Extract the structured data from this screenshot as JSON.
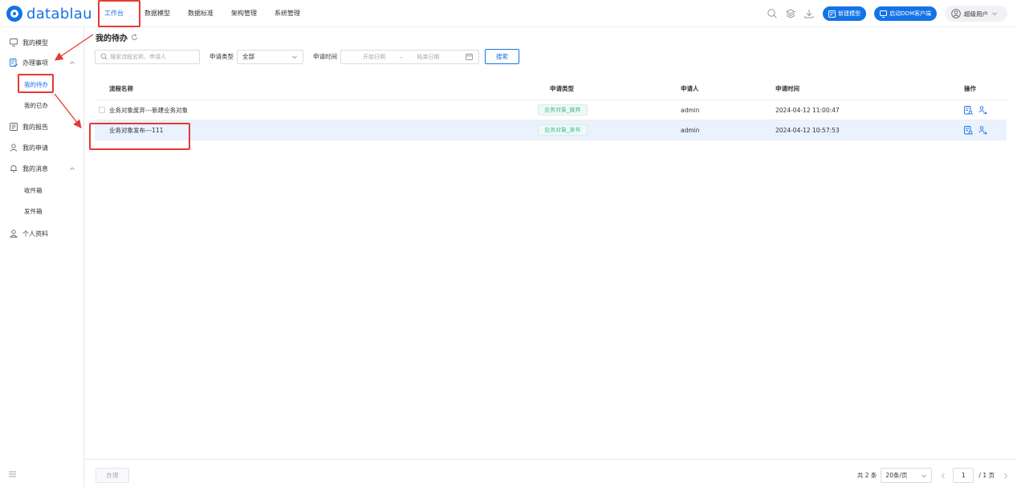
{
  "app": {
    "logo_text": "datablau",
    "accent": "#1473e6",
    "highlight": "#e53935"
  },
  "nav": {
    "items": [
      {
        "label": "工作台",
        "active": true
      },
      {
        "label": "数据模型"
      },
      {
        "label": "数据标准"
      },
      {
        "label": "架构管理"
      },
      {
        "label": "系统管理"
      }
    ]
  },
  "topbar": {
    "icons": [
      "search-icon",
      "layers-icon",
      "download-icon"
    ],
    "new_model_label": "新建模型",
    "ddm_client_label": "启动DDM客户端",
    "user_label": "超级用户"
  },
  "sidebar": {
    "items": [
      {
        "label": "我的模型",
        "icon": "monitor-icon"
      },
      {
        "label": "办理事项",
        "icon": "task-icon"
      },
      {
        "label": "我的待办"
      },
      {
        "label": "我的已办"
      },
      {
        "label": "我的报告",
        "icon": "report-icon"
      },
      {
        "label": "我的申请",
        "icon": "apply-icon"
      },
      {
        "label": "我的消息",
        "icon": "bell-icon"
      },
      {
        "label": "收件箱"
      },
      {
        "label": "发件箱"
      },
      {
        "label": "个人资料",
        "icon": "user-icon"
      }
    ]
  },
  "main": {
    "title": "我的待办",
    "filters": {
      "search_placeholder": "搜索流程名称、申请人",
      "type_label": "申请类型",
      "type_value": "全部",
      "time_label": "申请时间",
      "start_placeholder": "开始日期",
      "range_sep": "–",
      "end_placeholder": "结束日期",
      "search_button": "搜索"
    },
    "table": {
      "headers": {
        "name": "流程名称",
        "type": "申请类型",
        "user": "申请人",
        "time": "申请时间",
        "ops": "操作"
      },
      "rows": [
        {
          "name": "业务对象废弃---新建业务对象",
          "type": "业务对象_废弃",
          "user": "admin",
          "time": "2024-04-12 11:00:47"
        },
        {
          "name": "业务对象发布---111",
          "type": "业务对象_发布",
          "user": "admin",
          "time": "2024-04-12 10:57:53"
        }
      ]
    }
  },
  "footer": {
    "handle_button": "办理",
    "total_text": "共 2 条",
    "page_size": "20条/页",
    "page_number": "1",
    "page_total": "/ 1 页"
  }
}
